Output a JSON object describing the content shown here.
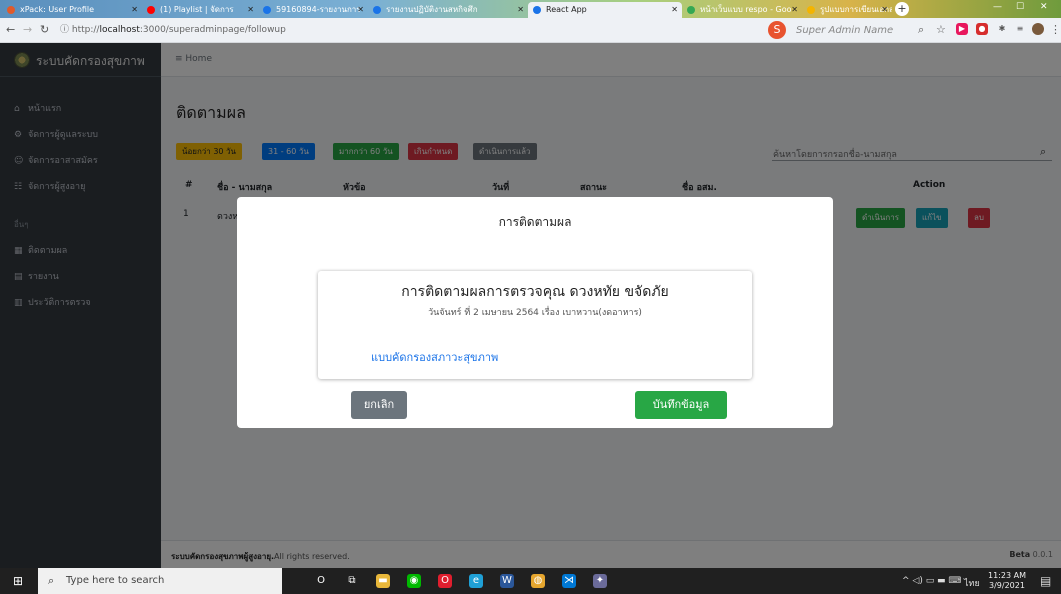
{
  "browser": {
    "tabs": [
      {
        "label": "xPack: User Profile",
        "color": "#e05a2b"
      },
      {
        "label": "(1) Playlist | จัดการ",
        "color": "#ff0000"
      },
      {
        "label": "59160894-รายงานการ",
        "color": "#1a73e8"
      },
      {
        "label": "รายงานปฏิบัติงานสหกิจศึก",
        "color": "#1a73e8"
      },
      {
        "label": "React App",
        "color": "#1a73e8"
      },
      {
        "label": "หน้าเว็บแบบ respo - Goo",
        "color": "#34a853"
      },
      {
        "label": "รูปแบบการเขียนเอกสาร",
        "color": "#f4b400"
      }
    ],
    "new_tab": "+",
    "url_prefix": "http://",
    "url_host": "localhost",
    "url_path": ":3000/superadminpage/followup"
  },
  "sidebar": {
    "brand": "ระบบคัดกรองสุขภาพ",
    "items": [
      {
        "label": "หน้าแรก",
        "icon": "home-icon",
        "glyph": "⌂"
      },
      {
        "label": "จัดการผู้ดูแลระบบ",
        "icon": "users-cog-icon",
        "glyph": "⚙"
      },
      {
        "label": "จัดการอาสาสมัคร",
        "icon": "user-icon",
        "glyph": "☺"
      },
      {
        "label": "จัดการผู้สูงอายุ",
        "icon": "users-icon",
        "glyph": "☷"
      }
    ],
    "section_header": "อื่นๆ",
    "other_items": [
      {
        "label": "ติดตามผล",
        "icon": "calendar-icon",
        "glyph": "▦"
      },
      {
        "label": "รายงาน",
        "icon": "file-icon",
        "glyph": "▤"
      },
      {
        "label": "ประวัติการตรวจ",
        "icon": "book-icon",
        "glyph": "▥"
      }
    ]
  },
  "topnav": {
    "menu_label": "≡ Home",
    "avatar_letter": "S",
    "username": "Super Admin Name"
  },
  "page": {
    "title": "ติดตามผล",
    "filters": [
      {
        "label": "น้อยกว่า 30 วัน",
        "color": "#ffc107",
        "text_color": "#212529"
      },
      {
        "label": "31 - 60 วัน",
        "color": "#007bff",
        "text_color": "#ffffff"
      },
      {
        "label": "มากกว่า 60 วัน",
        "color": "#28a745",
        "text_color": "#ffffff"
      },
      {
        "label": "เกินกำหนด",
        "color": "#dc3545",
        "text_color": "#ffffff"
      },
      {
        "label": "ดำเนินการแล้ว",
        "color": "#6c757d",
        "text_color": "#ffffff"
      }
    ],
    "search_placeholder": "ค้นหาโดยการกรอกชื่อ-นามสกุล",
    "table_headers": [
      "#",
      "ชื่อ - นามสกุล",
      "หัวข้อ",
      "วันที่",
      "สถานะ",
      "ชื่อ อสม.",
      "Action"
    ],
    "row": {
      "no": "1",
      "name": "ดวงห"
    },
    "row_actions": [
      {
        "label": "ดำเนินการ",
        "color": "#28a745"
      },
      {
        "label": "แก้ไข",
        "color": "#17a2b8"
      },
      {
        "label": "ลบ",
        "color": "#dc3545"
      }
    ]
  },
  "footer": {
    "brand": "ระบบคัดกรองสุขภาพผู้สูงอายุ.",
    "rights": "All rights reserved.",
    "version_label": "Beta",
    "version": "0.0.1"
  },
  "modal": {
    "title": "การติดตามผล",
    "card_title": "การติดตามผลการตรวจคุณ ดวงหทัย ขจัดภัย",
    "card_subtitle": "วันจันทร์ ที่ 2 เมษายน 2564 เรื่อง เบาหวาน(งดอาหาร)",
    "card_link": "แบบคัดกรองสภาวะสุขภาพ",
    "cancel_label": "ยกเลิก",
    "save_label": "บันทึกข้อมูล"
  },
  "taskbar": {
    "search_placeholder": "Type here to search",
    "apps": [
      {
        "name": "cortana-icon",
        "glyph": "O",
        "color": "#202020"
      },
      {
        "name": "task-view-icon",
        "glyph": "⧉",
        "color": "#202020"
      },
      {
        "name": "file-explorer-icon",
        "glyph": "▬",
        "color": "#e8b73a"
      },
      {
        "name": "line-icon",
        "glyph": "◉",
        "color": "#00b900"
      },
      {
        "name": "opera-icon",
        "glyph": "O",
        "color": "#e01e2e"
      },
      {
        "name": "edge-icon",
        "glyph": "e",
        "color": "#1fa0d6"
      },
      {
        "name": "word-icon",
        "glyph": "W",
        "color": "#2b579a"
      },
      {
        "name": "chrome-icon",
        "glyph": "◍",
        "color": "#e6a62e"
      },
      {
        "name": "vscode-icon",
        "glyph": "⋊",
        "color": "#0078d4"
      },
      {
        "name": "game-icon",
        "glyph": "✦",
        "color": "#6b6b9a"
      }
    ],
    "tray_lang": "ไทย",
    "time": "11:23 AM",
    "date": "3/9/2021"
  }
}
